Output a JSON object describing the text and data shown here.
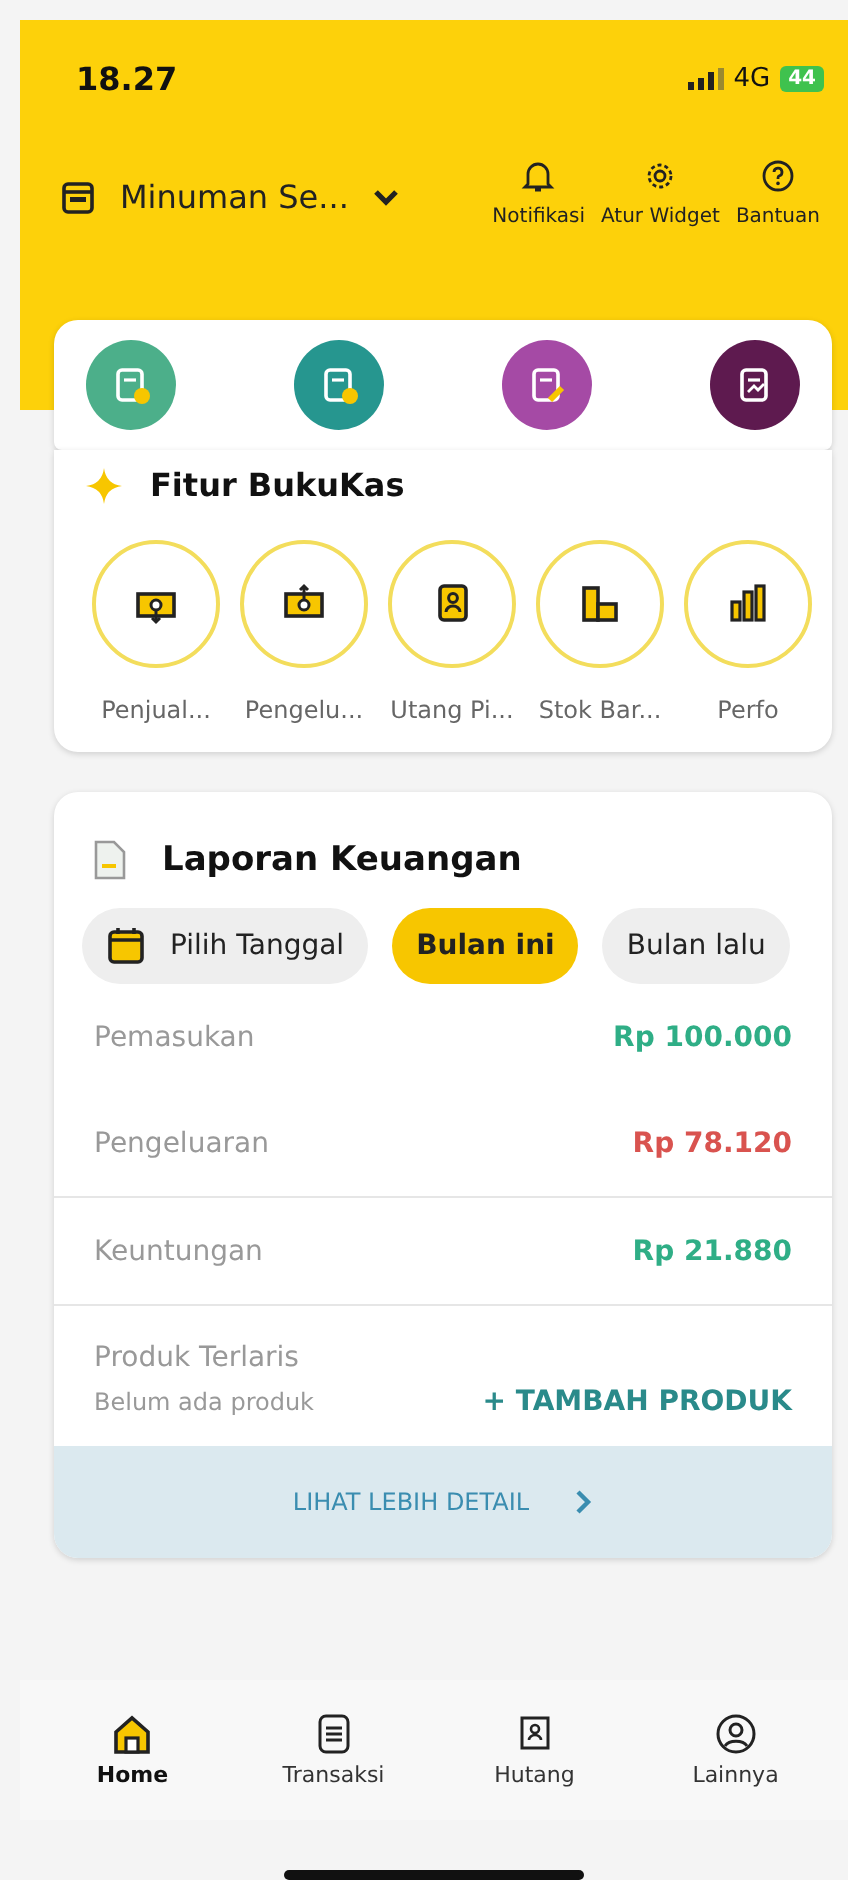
{
  "status_bar": {
    "time": "18.27",
    "network": "4G",
    "battery": "44"
  },
  "header": {
    "store_name": "Minuman Se...",
    "actions": [
      {
        "kind": "bell",
        "label": "Notifikasi"
      },
      {
        "kind": "gear",
        "label": "Atur Widget"
      },
      {
        "kind": "help",
        "label": "Bantuan"
      }
    ]
  },
  "quick_actions": [
    {
      "kind": "note-add",
      "color": "#4caf8a"
    },
    {
      "kind": "receipt-add",
      "color": "#26968f"
    },
    {
      "kind": "edit",
      "color": "#a54aa5"
    },
    {
      "kind": "report",
      "color": "#5e1a4f"
    }
  ],
  "features": {
    "title": "Fitur BukuKas",
    "items": [
      {
        "kind": "income",
        "label": "Penjual..."
      },
      {
        "kind": "expense",
        "label": "Pengelu..."
      },
      {
        "kind": "debt",
        "label": "Utang Pi..."
      },
      {
        "kind": "stock",
        "label": "Stok Bar..."
      },
      {
        "kind": "chart",
        "label": "Perfo"
      }
    ]
  },
  "report": {
    "title": "Laporan Keuangan",
    "filters": [
      {
        "label": "Pilih Tanggal",
        "kind": "date",
        "selected": false
      },
      {
        "label": "Bulan ini",
        "kind": "plain",
        "selected": true
      },
      {
        "label": "Bulan lalu",
        "kind": "plain",
        "selected": false
      }
    ],
    "rows": [
      {
        "label": "Pemasukan",
        "value": "Rp 100.000",
        "kind": "income"
      },
      {
        "label": "Pengeluaran",
        "value": "Rp 78.120",
        "kind": "expense"
      },
      {
        "label": "Keuntungan",
        "value": "Rp 21.880",
        "kind": "profit"
      }
    ],
    "best_sellers": {
      "title": "Produk Terlaris",
      "empty_text": "Belum ada produk",
      "action": "+ TAMBAH PRODUK"
    },
    "detail_link": "LIHAT LEBIH DETAIL"
  },
  "bottom_nav": [
    {
      "kind": "home",
      "label": "Home",
      "selected": true
    },
    {
      "kind": "list",
      "label": "Transaksi",
      "selected": false
    },
    {
      "kind": "debt",
      "label": "Hutang",
      "selected": false
    },
    {
      "kind": "user",
      "label": "Lainnya",
      "selected": false
    }
  ]
}
